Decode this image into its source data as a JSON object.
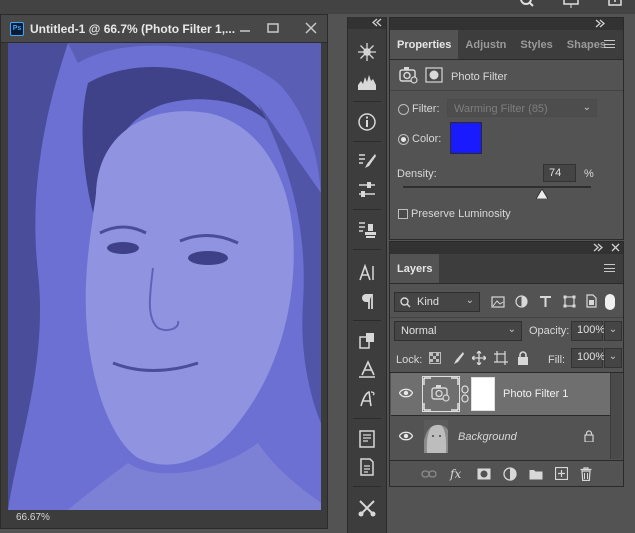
{
  "document": {
    "title": "Untitled-1 @ 66.7% (Photo Filter 1,...",
    "app_badge": "Ps",
    "zoom": "66.67%",
    "window_buttons": [
      "minimize",
      "maximize",
      "close"
    ]
  },
  "properties": {
    "tabs": [
      {
        "label": "Properties",
        "active": true
      },
      {
        "label": "Adjustn",
        "active": false
      },
      {
        "label": "Styles",
        "active": false
      },
      {
        "label": "Shapes",
        "active": false
      }
    ],
    "adjustment_name": "Photo Filter",
    "filter_label": "Filter:",
    "filter_value": "Warming Filter (85)",
    "color_label": "Color:",
    "color_value": "#1a1aff",
    "density_label": "Density:",
    "density_value": "74",
    "density_unit": "%",
    "density_fraction": 0.74,
    "preserve_label": "Preserve Luminosity",
    "selected_option": "color"
  },
  "layers": {
    "tab_label": "Layers",
    "kind_filter": "Kind",
    "blend_mode": "Normal",
    "opacity_label": "Opacity:",
    "opacity_value": "100%",
    "lock_label": "Lock:",
    "fill_label": "Fill:",
    "fill_value": "100%",
    "items": [
      {
        "name": "Photo Filter 1",
        "selected": true,
        "visible": true
      },
      {
        "name": "Background",
        "selected": false,
        "visible": true,
        "locked": true
      }
    ],
    "bottom_icons": [
      "link-icon",
      "fx-icon",
      "mask-icon",
      "adjustment-icon",
      "folder-icon",
      "new-layer-icon",
      "trash-icon"
    ]
  },
  "colors": {
    "panel_bg": "#535353",
    "dark_bg": "#3d3d3d",
    "selected_row": "#6f6f6f",
    "tint": "#6a6fd0"
  }
}
